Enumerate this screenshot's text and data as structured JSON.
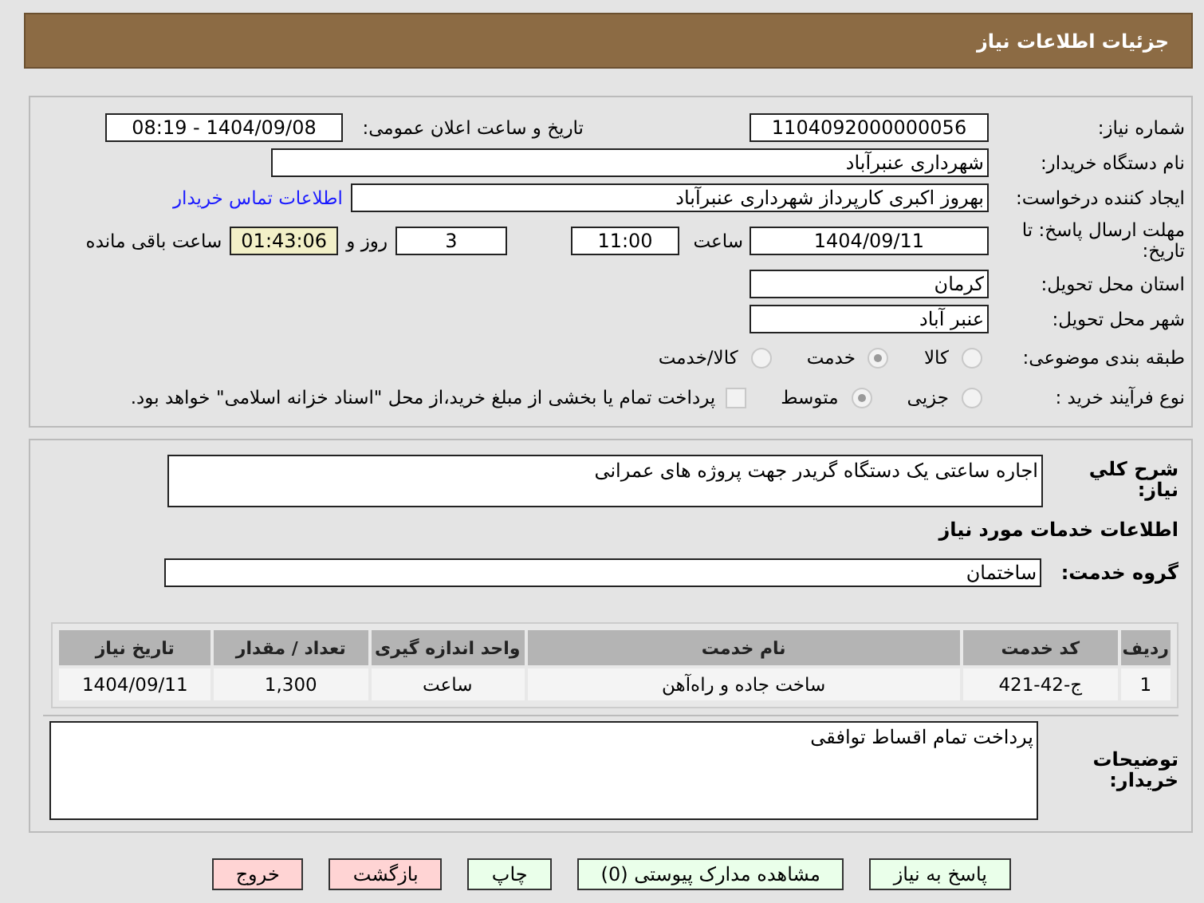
{
  "header": {
    "title": "جزئیات اطلاعات نیاز"
  },
  "details": {
    "need_number": {
      "label": "شماره نیاز:",
      "value": "1104092000000056"
    },
    "announce": {
      "label": "تاریخ و ساعت اعلان عمومی:",
      "value": "1404/09/08 - 08:19"
    },
    "buyer_org": {
      "label": "نام دستگاه خریدار:",
      "value": "شهرداری عنبرآباد"
    },
    "requester": {
      "label": "ایجاد کننده درخواست:",
      "value": "بهروز اکبری کارپرداز شهرداری عنبرآباد",
      "link": "اطلاعات تماس خریدار"
    },
    "deadline": {
      "label": "مهلت ارسال پاسخ: تا تاریخ:",
      "date": "1404/09/11",
      "time_label": "ساعت",
      "time": "11:00",
      "days": "3",
      "days_label": "روز و",
      "remaining": "01:43:06",
      "remaining_label": "ساعت باقی مانده"
    },
    "province": {
      "label": "استان محل تحویل:",
      "value": "کرمان"
    },
    "city": {
      "label": "شهر محل تحویل:",
      "value": "عنبر آباد"
    },
    "category": {
      "label": "طبقه بندی موضوعی:",
      "options": [
        {
          "label": "کالا",
          "selected": false
        },
        {
          "label": "خدمت",
          "selected": true
        },
        {
          "label": "کالا/خدمت",
          "selected": false
        }
      ]
    },
    "process": {
      "label": "نوع فرآیند خرید :",
      "options": [
        {
          "label": "جزیی",
          "selected": false
        },
        {
          "label": "متوسط",
          "selected": true
        }
      ],
      "treasury": {
        "label": "پرداخت تمام یا بخشی از مبلغ خرید،از محل \"اسناد خزانه اسلامی\" خواهد بود.",
        "checked": false
      }
    }
  },
  "summary": {
    "label": "شرح کلي نیاز:",
    "value": "اجاره ساعتی یک دستگاه گریدر جهت پروژه های عمرانی"
  },
  "services_heading": "اطلاعات خدمات مورد نیاز",
  "service_group": {
    "label": "گروه خدمت:",
    "value": "ساختمان"
  },
  "table": {
    "columns": [
      "ردیف",
      "کد خدمت",
      "نام خدمت",
      "واحد اندازه گیری",
      "تعداد / مقدار",
      "تاریخ نیاز"
    ],
    "rows": [
      [
        "1",
        "ج-42-421",
        "ساخت جاده و راه‌آهن",
        "ساعت",
        "1,300",
        "1404/09/11"
      ]
    ]
  },
  "buyer_notes": {
    "label": "توضیحات خریدار:",
    "value": "پرداخت تمام اقساط توافقی"
  },
  "buttons": [
    {
      "label": "پاسخ به نیاز",
      "kind": "ok"
    },
    {
      "label": "مشاهده مدارک پیوستی (0)",
      "kind": "ok"
    },
    {
      "label": "چاپ",
      "kind": "ok"
    },
    {
      "label": "بازگشت",
      "kind": "danger"
    },
    {
      "label": "خروج",
      "kind": "danger"
    }
  ]
}
